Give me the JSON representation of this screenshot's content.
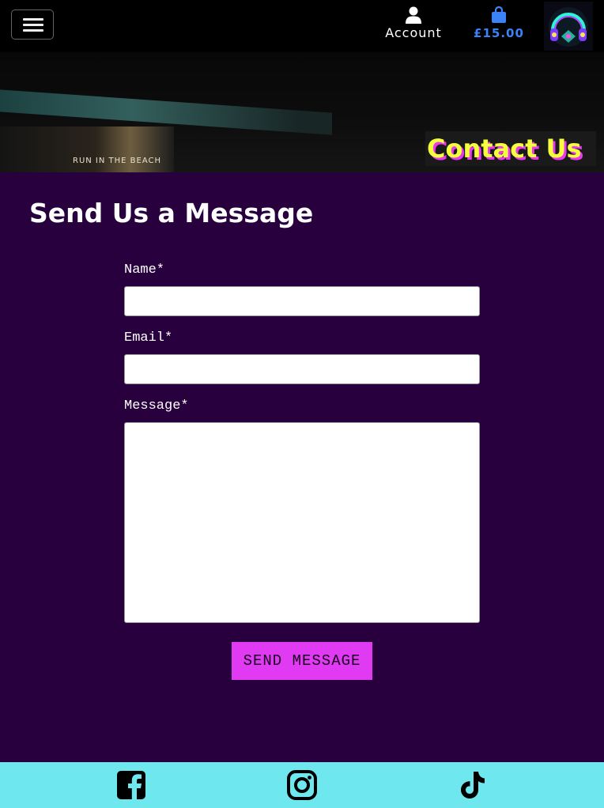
{
  "header": {
    "account_label": "Account",
    "bag_total": "£15.00",
    "accent_color": "#3b82f6",
    "icons": [
      "hamburger-icon",
      "user-icon",
      "shopping-bag-icon",
      "headphones-logo"
    ]
  },
  "hero": {
    "title": "Contact Us",
    "sign_text": "RUN IN THE BEACH"
  },
  "main": {
    "heading": "Send Us a Message"
  },
  "form": {
    "name_label": "Name*",
    "name_value": "",
    "email_label": "Email*",
    "email_value": "",
    "message_label": "Message*",
    "message_value": "",
    "submit_label": "SEND MESSAGE",
    "submit_color": "#e03af2"
  },
  "footer": {
    "background_color": "#6fe7ee",
    "social_icons": [
      "facebook-icon",
      "instagram-icon",
      "tiktok-icon"
    ]
  }
}
